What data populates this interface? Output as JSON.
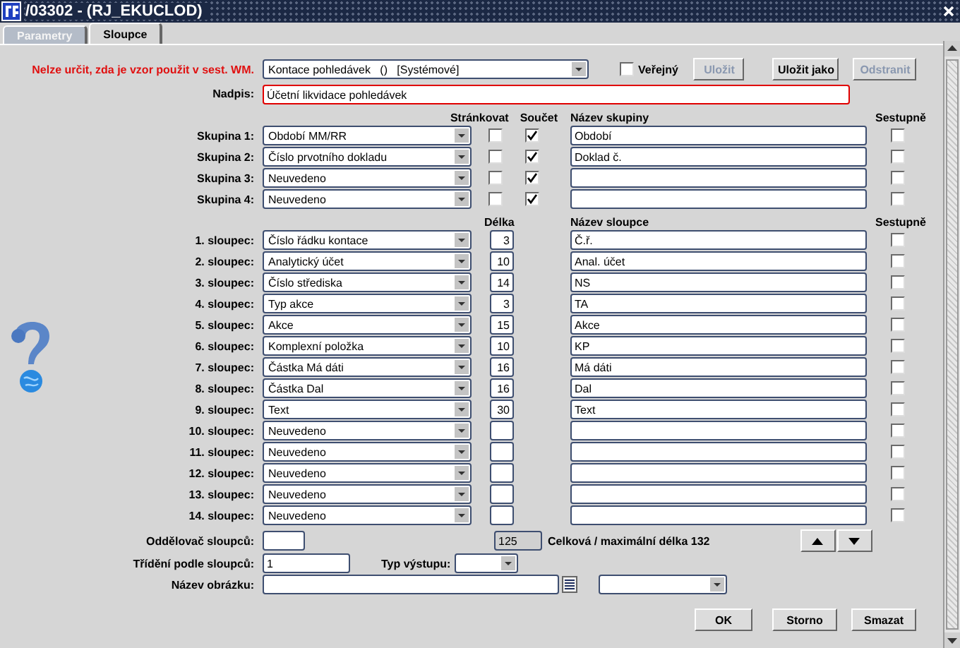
{
  "window": {
    "title": "/03302 - (RJ_EKUCLOD)"
  },
  "tabs": [
    {
      "label": "Parametry",
      "selected": false
    },
    {
      "label": "Sloupce",
      "selected": true
    }
  ],
  "template": {
    "warning": "Nelze určit, zda je vzor použit v sest. WM.",
    "value": "Kontace pohledávek   ()   [Systémové]",
    "public": {
      "label": "Veřejný",
      "checked": false
    },
    "buttons": [
      {
        "label": "Uložit",
        "disabled": true
      },
      {
        "label": "Uložit jako",
        "disabled": false
      },
      {
        "label": "Odstranit",
        "disabled": true
      }
    ]
  },
  "heading": {
    "label": "Nadpis:",
    "value": "Účetní likvidace pohledávek"
  },
  "group_header": {
    "paging": "Stránkovat",
    "sum": "Součet",
    "name": "Název skupiny",
    "descending": "Sestupně"
  },
  "groups": [
    {
      "label": "Skupina 1:",
      "value": "Období MM/RR",
      "paging": false,
      "sum": true,
      "name": "Období",
      "descending": false
    },
    {
      "label": "Skupina 2:",
      "value": "Číslo prvotního dokladu",
      "paging": false,
      "sum": true,
      "name": "Doklad č.",
      "descending": false
    },
    {
      "label": "Skupina 3:",
      "value": "Neuvedeno",
      "paging": false,
      "sum": true,
      "descending": false
    },
    {
      "label": "Skupina 4:",
      "value": "Neuvedeno",
      "paging": false,
      "sum": true,
      "descending": false
    }
  ],
  "column_header": {
    "length": "Délka",
    "name": "Název sloupce",
    "descending": "Sestupně"
  },
  "columns": [
    {
      "label": "1. sloupec:",
      "value": "Číslo řádku kontace",
      "length": "3",
      "name": "Č.ř.",
      "descending": false
    },
    {
      "label": "2. sloupec:",
      "value": "Analytický účet",
      "length": "10",
      "name": "Anal. účet",
      "descending": false
    },
    {
      "label": "3. sloupec:",
      "value": "Číslo střediska",
      "length": "14",
      "name": "NS",
      "descending": false
    },
    {
      "label": "4. sloupec:",
      "value": "Typ akce",
      "length": "3",
      "name": "TA",
      "descending": false
    },
    {
      "label": "5. sloupec:",
      "value": "Akce",
      "length": "15",
      "name": "Akce",
      "descending": false
    },
    {
      "label": "6. sloupec:",
      "value": "Komplexní položka",
      "length": "10",
      "name": "KP",
      "descending": false
    },
    {
      "label": "7. sloupec:",
      "value": "Částka Má dáti",
      "length": "16",
      "name": "Má dáti",
      "descending": false
    },
    {
      "label": "8. sloupec:",
      "value": "Částka Dal",
      "length": "16",
      "name": "Dal",
      "descending": false
    },
    {
      "label": "9. sloupec:",
      "value": "Text",
      "length": "30",
      "name": "Text",
      "descending": false
    },
    {
      "label": "10. sloupec:",
      "value": "Neuvedeno",
      "descending": false
    },
    {
      "label": "11. sloupec:",
      "value": "Neuvedeno",
      "descending": false
    },
    {
      "label": "12. sloupec:",
      "value": "Neuvedeno",
      "descending": false
    },
    {
      "label": "13. sloupec:",
      "value": "Neuvedeno",
      "descending": false
    },
    {
      "label": "14. sloupec:",
      "value": "Neuvedeno",
      "descending": false
    }
  ],
  "separator": {
    "label": "Oddělovač sloupců:"
  },
  "total": {
    "value": "125",
    "text": "Celková / maximální délka 132"
  },
  "sort": {
    "label": "Třídění podle sloupců:",
    "value": "1"
  },
  "output_type": {
    "label": "Typ výstupu:"
  },
  "image_name": {
    "label": "Název obrázku:"
  },
  "buttons": [
    {
      "label": "OK"
    },
    {
      "label": "Storno"
    },
    {
      "label": "Smazat"
    }
  ]
}
